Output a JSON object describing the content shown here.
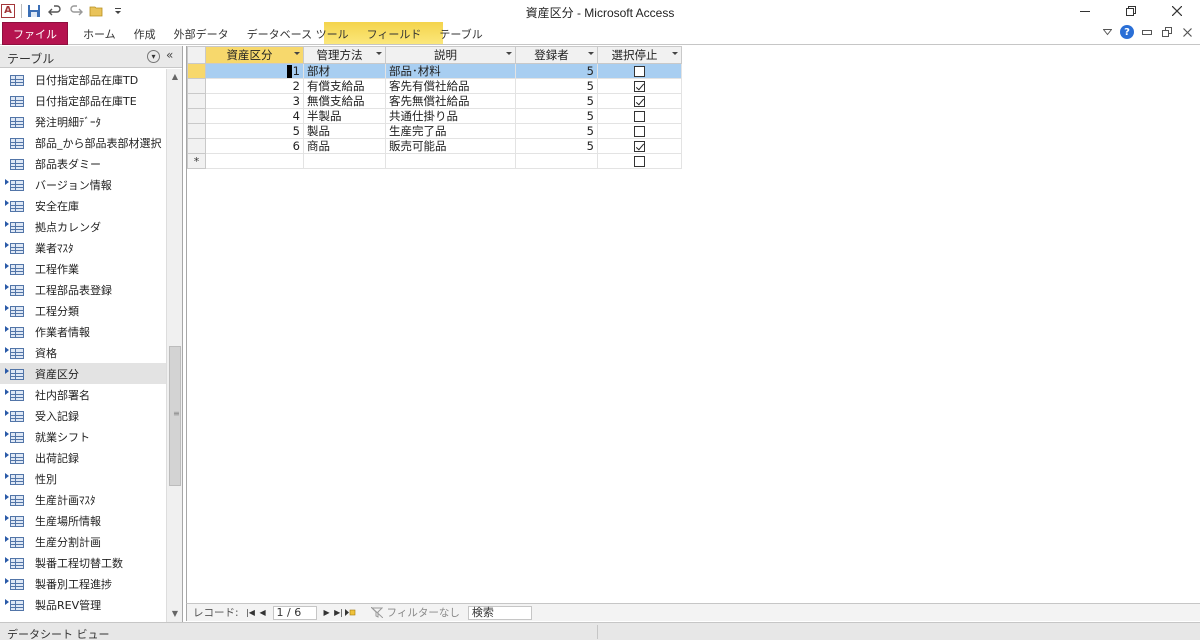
{
  "window": {
    "title": "資産区分 - Microsoft Access"
  },
  "ribbon": {
    "contextual_header": "テーブル ツール",
    "tabs": [
      {
        "label": "ファイル"
      },
      {
        "label": "ホーム"
      },
      {
        "label": "作成"
      },
      {
        "label": "外部データ"
      },
      {
        "label": "データベース ツール"
      },
      {
        "label": "フィールド"
      },
      {
        "label": "テーブル"
      }
    ]
  },
  "nav_pane": {
    "title": "テーブル",
    "items": [
      {
        "label": "日付指定部品在庫TD",
        "linked": false
      },
      {
        "label": "日付指定部品在庫TE",
        "linked": false
      },
      {
        "label": "発注明細ﾃﾞｰﾀ",
        "linked": false
      },
      {
        "label": "部品_から部品表部材選択",
        "linked": false
      },
      {
        "label": "部品表ダミー",
        "linked": false
      },
      {
        "label": "バージョン情報",
        "linked": true
      },
      {
        "label": "安全在庫",
        "linked": true
      },
      {
        "label": "拠点カレンダ",
        "linked": true
      },
      {
        "label": "業者ﾏｽﾀ",
        "linked": true
      },
      {
        "label": "工程作業",
        "linked": true
      },
      {
        "label": "工程部品表登録",
        "linked": true
      },
      {
        "label": "工程分類",
        "linked": true
      },
      {
        "label": "作業者情報",
        "linked": true
      },
      {
        "label": "資格",
        "linked": true
      },
      {
        "label": "資産区分",
        "linked": true,
        "selected": true
      },
      {
        "label": "社内部署名",
        "linked": true
      },
      {
        "label": "受入記録",
        "linked": true
      },
      {
        "label": "就業シフト",
        "linked": true
      },
      {
        "label": "出荷記録",
        "linked": true
      },
      {
        "label": "性別",
        "linked": true
      },
      {
        "label": "生産計画ﾏｽﾀ",
        "linked": true
      },
      {
        "label": "生産場所情報",
        "linked": true
      },
      {
        "label": "生産分割計画",
        "linked": true
      },
      {
        "label": "製番工程切替工数",
        "linked": true
      },
      {
        "label": "製番別工程進捗",
        "linked": true
      },
      {
        "label": "製品REV管理",
        "linked": true
      }
    ]
  },
  "datasheet": {
    "columns": [
      "資産区分",
      "管理方法",
      "説明",
      "登録者",
      "選択停止"
    ],
    "rows": [
      {
        "id": "1",
        "method": "部材",
        "desc": "部品･材料",
        "user": "5",
        "stopped": false
      },
      {
        "id": "2",
        "method": "有償支給品",
        "desc": "客先有償社給品",
        "user": "5",
        "stopped": true
      },
      {
        "id": "3",
        "method": "無償支給品",
        "desc": "客先無償社給品",
        "user": "5",
        "stopped": true
      },
      {
        "id": "4",
        "method": "半製品",
        "desc": "共通仕掛り品",
        "user": "5",
        "stopped": false
      },
      {
        "id": "5",
        "method": "製品",
        "desc": "生産完了品",
        "user": "5",
        "stopped": false
      },
      {
        "id": "6",
        "method": "商品",
        "desc": "販売可能品",
        "user": "5",
        "stopped": true
      }
    ],
    "new_row_marker": "*"
  },
  "record_nav": {
    "label": "レコード:",
    "position": "1 / 6",
    "filter_label": "フィルターなし",
    "search_label": "検索"
  },
  "status": {
    "text": "データシート ビュー"
  },
  "colors": {
    "file_tab": "#b5134f",
    "selected_row": "#a8cef1",
    "selected_header": "#f7d86c"
  }
}
